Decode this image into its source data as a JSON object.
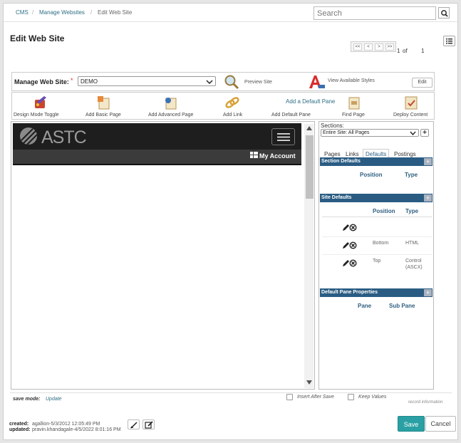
{
  "breadcrumb": {
    "items": [
      "CMS",
      "Manage Websites"
    ],
    "separator": "/",
    "current": "Edit Web Site"
  },
  "search": {
    "placeholder": "Search"
  },
  "page": {
    "title": "Edit Web Site"
  },
  "pager": {
    "first": "<<",
    "prev": "<",
    "next": ">",
    "last": ">>",
    "current": "1",
    "of_label": "of",
    "total": "1"
  },
  "manage": {
    "label": "Manage Web Site:",
    "required_mark": "*",
    "selected_site": "DEMO",
    "preview_label": "Preview Site",
    "styles_label": "View Available Styles",
    "edit_label": "Edit"
  },
  "toolbar": {
    "design_mode": "Design Mode Toggle",
    "add_basic": "Add Basic Page",
    "add_advanced": "Add Advanced Page",
    "add_link": "Add Link",
    "add_default_link": "Add a Default Pane",
    "add_default": "Add Default Pane",
    "find_page": "Find Page",
    "deploy": "Deploy Content"
  },
  "preview": {
    "logo_text": "ASTC",
    "account_label": "My Account"
  },
  "side": {
    "sections_label": "Sections:",
    "sections_selected": "Entire Site: All Pages",
    "tabs": [
      "Pages",
      "Links",
      "Defaults",
      "Postings"
    ],
    "section_defaults": {
      "title": "Section Defaults",
      "col_position": "Position",
      "col_type": "Type"
    },
    "site_defaults": {
      "title": "Site Defaults",
      "col_position": "Position",
      "col_type": "Type",
      "rows": [
        {
          "position": "",
          "type": ""
        },
        {
          "position": "Bottom",
          "type": "HTML"
        },
        {
          "position": "Top",
          "type": "Control",
          "type2": "(ASCX)"
        }
      ]
    },
    "pane_props": {
      "title": "Default Pane Properties",
      "col_pane": "Pane",
      "col_subpane": "Sub Pane"
    }
  },
  "footer": {
    "save_mode_label": "save mode:",
    "save_mode_value": "Update",
    "insert_after_save": "Insert After Save",
    "keep_values": "Keep Values",
    "record_info": "record information",
    "created_label": "created:",
    "created_value": "agallion-5/3/2012 12:05:49 PM",
    "updated_label": "updated:",
    "updated_value": "pravin.khandagale-4/5/2022 8:01:16 PM",
    "save": "Save",
    "cancel": "Cancel"
  },
  "colors": {
    "accent": "#2aa0a4",
    "section_bar": "#2a5c83",
    "link": "#2e6f84"
  }
}
